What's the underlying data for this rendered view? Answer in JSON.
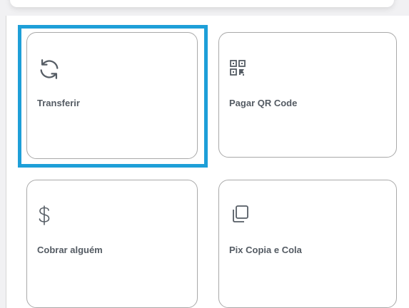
{
  "actions": [
    {
      "id": "transferir",
      "label": "Transferir",
      "icon": "refresh-arrows-icon"
    },
    {
      "id": "pagar-qr",
      "label": "Pagar QR Code",
      "icon": "qr-code-icon"
    },
    {
      "id": "cobrar",
      "label": "Cobrar alguém",
      "icon": "dollar-sign-icon"
    },
    {
      "id": "pix-copia",
      "label": "Pix Copia e Cola",
      "icon": "copy-icon"
    }
  ],
  "colors": {
    "highlight": "#1e9fd8",
    "tile_border": "#a9a9a9",
    "label_text": "#545b63"
  }
}
